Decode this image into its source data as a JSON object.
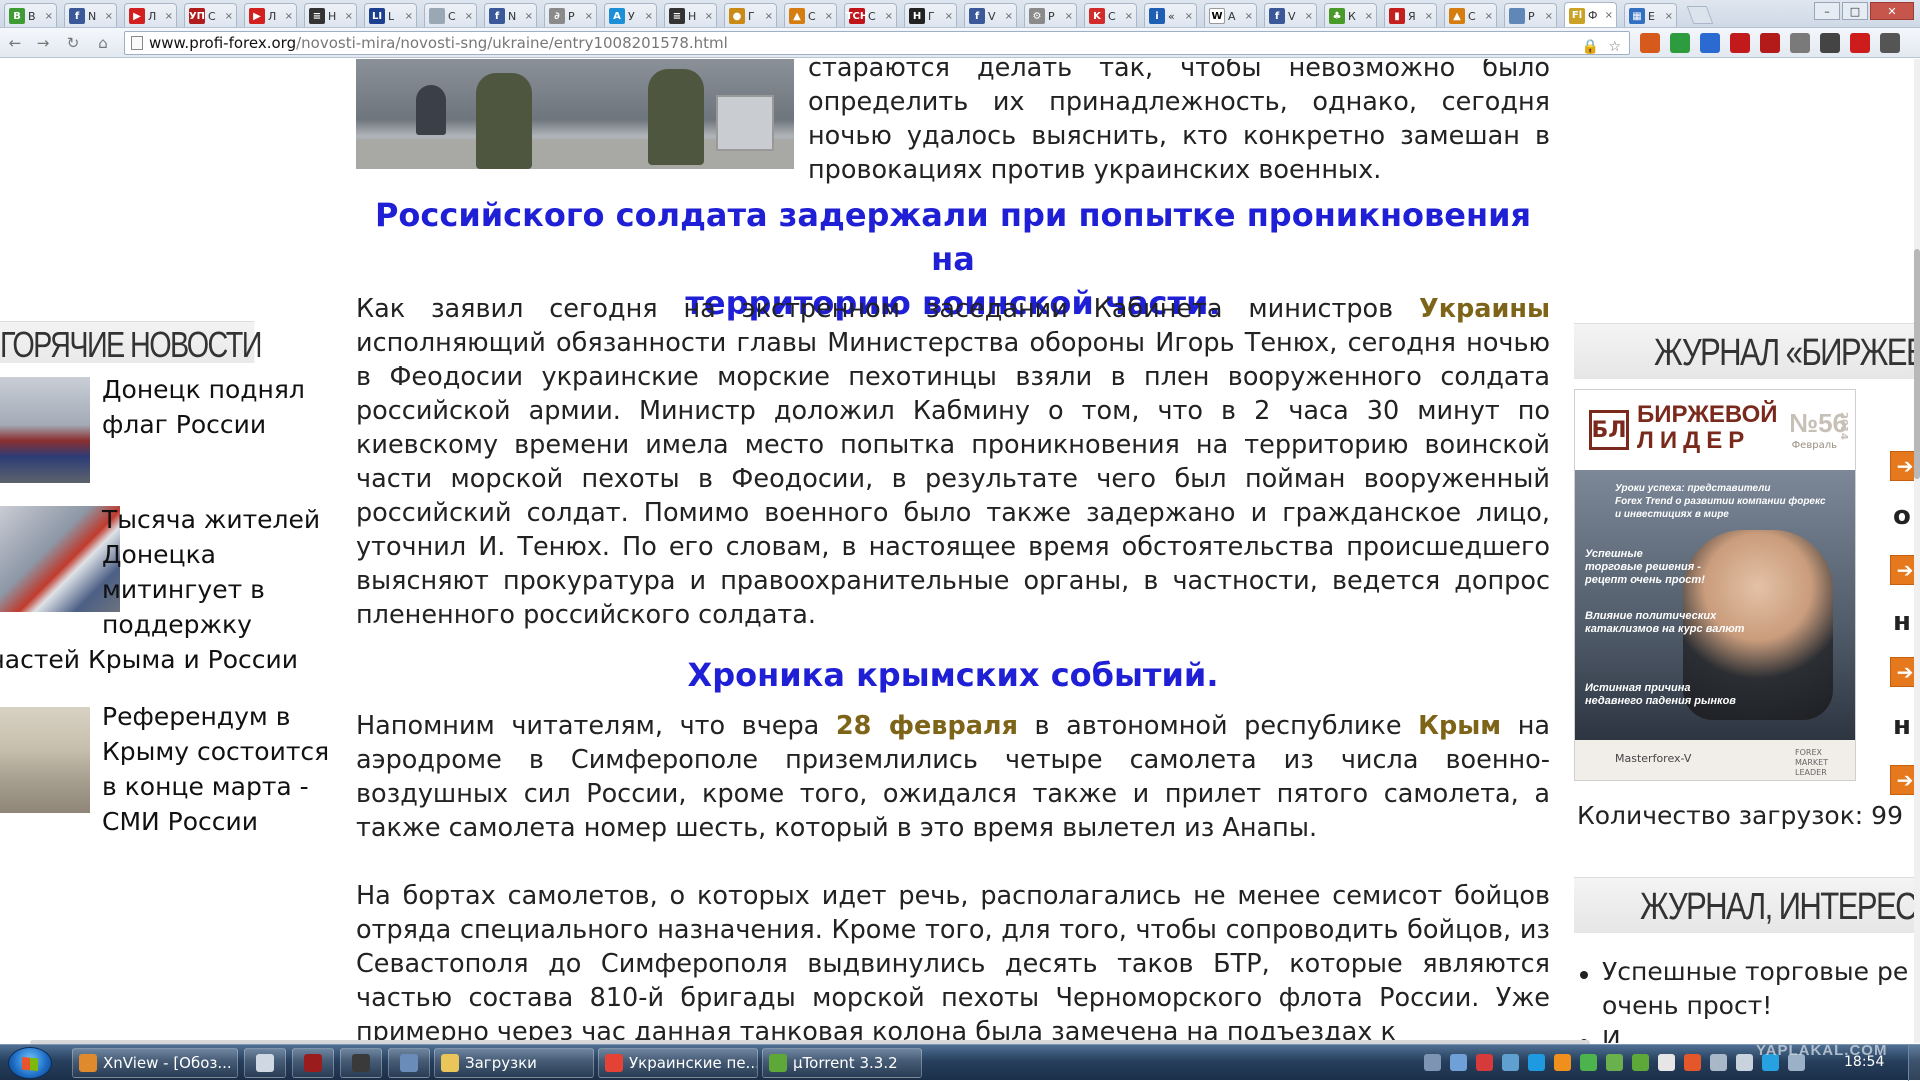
{
  "browser": {
    "tabs": [
      {
        "label": "В",
        "icon": "tab-favicon-green",
        "color": "#3f9c35",
        "glyph": "В"
      },
      {
        "label": "N",
        "icon": "facebook-icon",
        "color": "#3b5998",
        "glyph": "f"
      },
      {
        "label": "Л",
        "icon": "youtube-icon",
        "color": "#d21f1f",
        "glyph": "▶"
      },
      {
        "label": "С",
        "icon": "news-icon-red",
        "color": "#b01c1c",
        "glyph": "УП"
      },
      {
        "label": "Л",
        "icon": "youtube-icon",
        "color": "#d21f1f",
        "glyph": "▶"
      },
      {
        "label": "Н",
        "icon": "page-icon-dark",
        "color": "#333333",
        "glyph": "≡"
      },
      {
        "label": "L",
        "icon": "news-icon-blue",
        "color": "#1c3f8f",
        "glyph": "LI"
      },
      {
        "label": "С",
        "icon": "blank-page-icon",
        "color": "#9aa7b5",
        "glyph": ""
      },
      {
        "label": "N",
        "icon": "facebook-icon",
        "color": "#3b5998",
        "glyph": "f"
      },
      {
        "label": "Р",
        "icon": "link-icon",
        "color": "#8a8a8a",
        "glyph": "∂"
      },
      {
        "label": "У",
        "icon": "news-icon-cyan",
        "color": "#1c8fd6",
        "glyph": "А"
      },
      {
        "label": "Н",
        "icon": "page-icon-dark",
        "color": "#333333",
        "glyph": "≡"
      },
      {
        "label": "Г",
        "icon": "orange-circle-icon",
        "color": "#c98a18",
        "glyph": "●"
      },
      {
        "label": "С",
        "icon": "triangle-icon",
        "color": "#d67d12",
        "glyph": "▲"
      },
      {
        "label": "С",
        "icon": "tsn-icon",
        "color": "#c0141a",
        "glyph": "ТСН"
      },
      {
        "label": "Г",
        "icon": "h-icon",
        "color": "#222222",
        "glyph": "H"
      },
      {
        "label": "V",
        "icon": "facebook-icon",
        "color": "#3b5998",
        "glyph": "f"
      },
      {
        "label": "Р",
        "icon": "gear-icon",
        "color": "#8a8a8a",
        "glyph": "⚙"
      },
      {
        "label": "С",
        "icon": "k-icon",
        "color": "#d12b2b",
        "glyph": "K"
      },
      {
        "label": "«",
        "icon": "info-icon",
        "color": "#1e5fb3",
        "glyph": "i"
      },
      {
        "label": "А",
        "icon": "wikipedia-icon",
        "color": "#ffffff",
        "glyph": "W"
      },
      {
        "label": "V",
        "icon": "facebook-icon",
        "color": "#3b5998",
        "glyph": "f"
      },
      {
        "label": "К",
        "icon": "leaf-icon",
        "color": "#4a9a2a",
        "glyph": "♣"
      },
      {
        "label": "Я",
        "icon": "flag-icon",
        "color": "#c41e1e",
        "glyph": "▮"
      },
      {
        "label": "С",
        "icon": "triangle-icon",
        "color": "#d67d12",
        "glyph": "▲"
      },
      {
        "label": "Р",
        "icon": "blank-page-icon",
        "color": "#5f87b8",
        "glyph": ""
      },
      {
        "label": "Ф",
        "icon": "forex-icon",
        "color": "#c9a227",
        "glyph": "Fl"
      },
      {
        "label": "Е",
        "icon": "windows-icon",
        "color": "#3370c2",
        "glyph": "▦"
      }
    ],
    "active_tab_index": 26,
    "url_host": "www.profi-forex.org",
    "url_path": "/novosti-mira/novosti-sng/ukraine/entry1008201578.html",
    "extensions": [
      {
        "name": "bookmarks-icon",
        "color": "#d65a1c"
      },
      {
        "name": "earth-icon",
        "color": "#2e9b3e"
      },
      {
        "name": "translate-icon",
        "color": "#2a6ad1"
      },
      {
        "name": "adblock-icon",
        "color": "#c21a1a"
      },
      {
        "name": "lastpass-icon",
        "color": "#b31b1b"
      },
      {
        "name": "mail-icon",
        "color": "#7a7a7a"
      },
      {
        "name": "script-icon",
        "color": "#444444"
      },
      {
        "name": "abp-icon",
        "color": "#cc1c1c"
      },
      {
        "name": "menu-icon",
        "color": "#555555"
      }
    ]
  },
  "hot_news": {
    "heading": "ГОРЯЧИЕ НОВОСТИ",
    "items": [
      {
        "lines": [
          "Донецк поднял",
          "флаг России"
        ]
      },
      {
        "lines": [
          "Тысяча жителей",
          "Донецка",
          "митингует в",
          "поддержку",
          "частей Крыма и России"
        ]
      },
      {
        "lines": [
          "Референдум в",
          "Крыму состоится",
          "в конце марта -",
          "СМИ России"
        ]
      }
    ]
  },
  "article": {
    "intro_lines": [
      "стараются делать так, чтобы невозможно было",
      "определить их принадлежность, однако, сегодня",
      "ночью удалось выяснить, кто конкретно замешан в",
      "провокациях против украинских военных."
    ],
    "heading1_lines": [
      "Российского солдата задержали при попытке проникновения на",
      "территорию воинской части."
    ],
    "p1_before": "Как заявил сегодня на экстренном заседании Кабинета министров",
    "p1_hl": "Украины",
    "p1_after": "исполняющий обязанности главы Министерства обороны Игорь Тенюх, сегодня ночью в Феодосии украинские морские пехотинцы взяли в плен вооруженного солдата российской армии. Министр доложил Кабмину о том, что в 2 часа 30 минут по киевскому времени имела место попытка проникновения на территорию воинской части морской пехоты в Феодосии, в результате чего был пойман вооруженный российский солдат. Помимо военного было также задержано и гражданское лицо, уточнил И. Тенюх. По его словам, в настоящее время обстоятельства происшедшего выясняют прокуратура и правоохранительные органы, в частности, ведется допрос плененного российского солдата.",
    "heading2": "Хроника крымских событий.",
    "p2_a": "Напомним читателям, что вчера",
    "p2_hl1": "28 февраля",
    "p2_b": "в автономной республике",
    "p2_hl2": "Крым",
    "p2_c": "на аэродроме в Симферополе приземлились четыре самолета из числа военно-воздушных сил России, кроме того, ожидался также и прилет пятого самолета, а также самолета номер шесть, который в это время вылетел из Анапы.",
    "p3": "На бортах самолетов, о которых идет речь, располагались не менее семисот бойцов отряда специального назначения. Кроме того, для того, чтобы сопроводить бойцов, из Севастополя до Симферополя выдвинулись десять таков БТР, которые являются частью состава 810-й бригады морской пехоты Черноморского флота России. Уже примерно через час данная танковая колона была замечена на подъездах к"
  },
  "right_sidebar": {
    "journal_heading": "ЖУРНАЛ «БИРЖЕВ",
    "magazine": {
      "logo": "БЛ",
      "title_line1": "БИРЖЕВОЙ",
      "title_line2": "ЛИДЕР",
      "issue": "№56",
      "year": "2014",
      "month": "Февраль",
      "lines": [
        "Уроки успеха: представители",
        "Forex Trend о развитии компании форекс",
        "и инвестициях в мире",
        "Успешные",
        "торговые решения -",
        "рецепт очень прост!",
        "Влияние политических",
        "катаклизмов на курс валют",
        "Истинная причина",
        "недавнего падения рынков"
      ],
      "footer_left": "Masterforex-V",
      "footer_right": "FOREX MARKET LEADER"
    },
    "side_letters": [
      "о",
      "н",
      "н"
    ],
    "downloads": "Количество загрузок: 99",
    "interesting_heading": "ЖУРНАЛ, ИНТЕРЕС",
    "bullets": [
      {
        "lines": [
          "Успешные торговые ре",
          "очень прост!"
        ]
      },
      {
        "lines": [
          "И"
        ]
      }
    ]
  },
  "taskbar": {
    "buttons": [
      {
        "label": "XnView - [Обоз...",
        "icon": "xnview-icon",
        "color": "#e08a2e"
      },
      {
        "label": "",
        "icon": "document-icon",
        "color": "#cfd8e3"
      },
      {
        "label": "",
        "icon": "game-icon",
        "color": "#9b1c1c"
      },
      {
        "label": "",
        "icon": "feather-icon",
        "color": "#3a3a3a"
      },
      {
        "label": "",
        "icon": "window-app-icon",
        "color": "#6a8cb8"
      },
      {
        "label": "Загрузки",
        "icon": "folder-icon",
        "color": "#e9c55a"
      },
      {
        "label": "Украинские пе...",
        "icon": "chrome-icon",
        "color": "#e34234"
      },
      {
        "label": "µTorrent 3.3.2",
        "icon": "utorrent-icon",
        "color": "#5ea83a"
      }
    ],
    "tray_icons": [
      {
        "name": "expand-tray-icon",
        "color": "#7d95b3"
      },
      {
        "name": "network-icon",
        "color": "#6fa0d8"
      },
      {
        "name": "language-flag-icon",
        "color": "#d63a3a"
      },
      {
        "name": "cloud-icon",
        "color": "#5fa0d0"
      },
      {
        "name": "skype-icon",
        "color": "#1d9ae0"
      },
      {
        "name": "orange-app-icon",
        "color": "#f0901c"
      },
      {
        "name": "green-check-icon",
        "color": "#4db34d"
      },
      {
        "name": "leaf-tray-icon",
        "color": "#6ab04c"
      },
      {
        "name": "utorrent-tray-icon",
        "color": "#5ea83a"
      },
      {
        "name": "white-app-icon",
        "color": "#e6e6e6"
      },
      {
        "name": "flash-icon",
        "color": "#e3572b"
      },
      {
        "name": "monitor-icon",
        "color": "#a9b8c9"
      },
      {
        "name": "volume-icon",
        "color": "#c9d3de"
      },
      {
        "name": "app-tray-icon",
        "color": "#26a2e0"
      },
      {
        "name": "grid-tray-icon",
        "color": "#9bb1c7"
      }
    ],
    "time": "18:54",
    "watermark": "YAPLAKAL.COM"
  }
}
